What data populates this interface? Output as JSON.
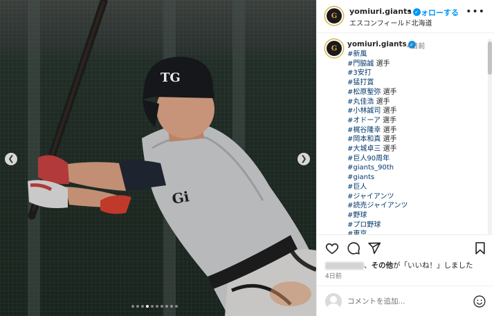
{
  "post": {
    "photo_alt": "",
    "carousel": {
      "dots": 10,
      "active_index": 3,
      "prev_icon": "chevron-left",
      "next_icon": "chevron-right"
    },
    "jersey_letters": "Gi",
    "helmet_logo": "TG"
  },
  "header": {
    "username": "yomiuri.giants",
    "separator": "•",
    "follow_label": "フォローする",
    "location": "エスコンフィールド北海道",
    "more_icon": "more-horizontal"
  },
  "caption": {
    "username": "yomiuri.giants",
    "time": "4日前",
    "hashtags": [
      {
        "tag": "#新風",
        "suffix": ""
      },
      {
        "tag": "#門脇誠",
        "suffix": " 選手"
      },
      {
        "tag": "#3安打",
        "suffix": ""
      },
      {
        "tag": "#猛打賞",
        "suffix": ""
      },
      {
        "tag": "#松原聖弥",
        "suffix": " 選手"
      },
      {
        "tag": "#丸佳浩",
        "suffix": " 選手"
      },
      {
        "tag": "#小林誠司",
        "suffix": " 選手"
      },
      {
        "tag": "#オドーア",
        "suffix": " 選手"
      },
      {
        "tag": "#梶谷隆幸",
        "suffix": " 選手"
      },
      {
        "tag": "#岡本和真",
        "suffix": " 選手"
      },
      {
        "tag": "#大城卓三",
        "suffix": " 選手"
      },
      {
        "tag": "#巨人90周年",
        "suffix": ""
      },
      {
        "tag": "#giants_90th",
        "suffix": ""
      },
      {
        "tag": "#giants",
        "suffix": ""
      },
      {
        "tag": "#巨人",
        "suffix": ""
      },
      {
        "tag": "#ジャイアンツ",
        "suffix": ""
      },
      {
        "tag": "#読売ジャイアンツ",
        "suffix": ""
      },
      {
        "tag": "#野球",
        "suffix": ""
      },
      {
        "tag": "#プロ野球",
        "suffix": ""
      },
      {
        "tag": "#東京",
        "suffix": ""
      }
    ]
  },
  "actions": {
    "icons": [
      "heart-icon",
      "comment-icon",
      "share-icon",
      "bookmark-icon"
    ],
    "likes_bold": "その他",
    "likes_text": "が「いいね！」しました",
    "likes_prefix": "、",
    "date": "4日前"
  },
  "comment": {
    "placeholder": "コメントを追加...",
    "emoji_icon": "smiley-icon"
  },
  "colors": {
    "link_blue": "#0095f6",
    "hashtag": "#00376b",
    "border": "#efefef",
    "text": "#262626",
    "muted": "#737373"
  }
}
